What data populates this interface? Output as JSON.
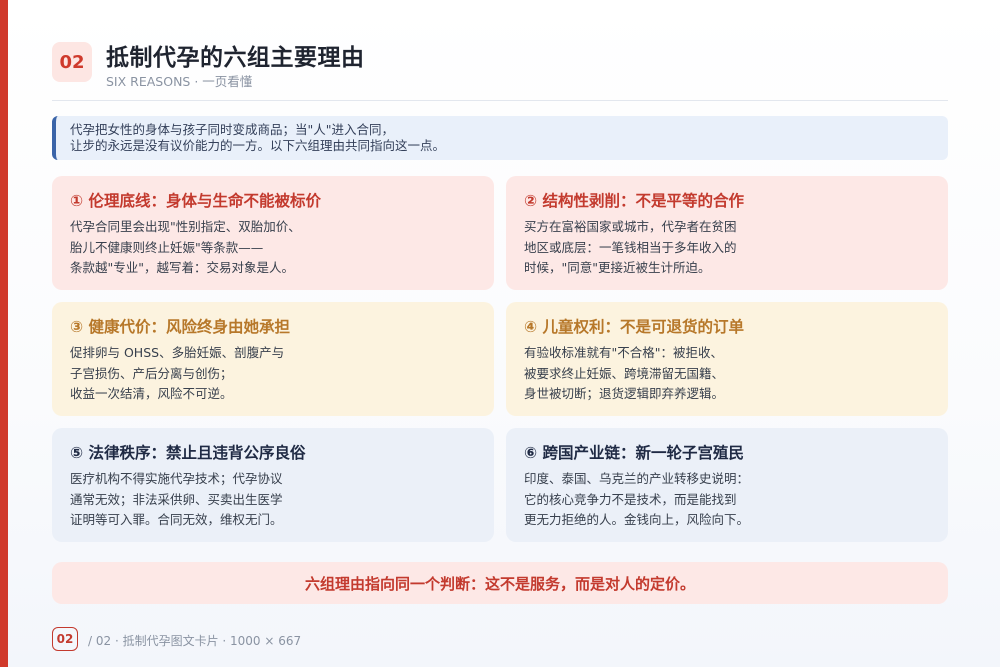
{
  "header": {
    "badge": "02",
    "title": "抵制代孕的六组主要理由",
    "subtitle": "SIX REASONS · 一页看懂"
  },
  "intro": {
    "lines": [
      "代孕把女性的身体与孩子同时变成商品；当\"人\"进入合同，",
      "让步的永远是没有议价能力的一方。以下六组理由共同指向这一点。"
    ]
  },
  "cards": [
    {
      "title": "① 伦理底线：身体与生命不能被标价",
      "lines": [
        "代孕合同里会出现\"性别指定、双胎加价、",
        "胎儿不健康则终止妊娠\"等条款——",
        "条款越\"专业\"，越写着：交易对象是人。"
      ]
    },
    {
      "title": "② 结构性剥削：不是平等的合作",
      "lines": [
        "买方在富裕国家或城市，代孕者在贫困",
        "地区或底层：一笔钱相当于多年收入的",
        "时候，\"同意\"更接近被生计所迫。"
      ]
    },
    {
      "title": "③ 健康代价：风险终身由她承担",
      "lines": [
        "促排卵与 OHSS、多胎妊娠、剖腹产与",
        "子宫损伤、产后分离与创伤；",
        "收益一次结清，风险不可逆。"
      ]
    },
    {
      "title": "④ 儿童权利：不是可退货的订单",
      "lines": [
        "有验收标准就有\"不合格\"：被拒收、",
        "被要求终止妊娠、跨境滞留无国籍、",
        "身世被切断；退货逻辑即弃养逻辑。"
      ]
    },
    {
      "title": "⑤ 法律秩序：禁止且违背公序良俗",
      "lines": [
        "医疗机构不得实施代孕技术；代孕协议",
        "通常无效；非法采供卵、买卖出生医学",
        "证明等可入罪。合同无效，维权无门。"
      ]
    },
    {
      "title": "⑥ 跨国产业链：新一轮子宫殖民",
      "lines": [
        "印度、泰国、乌克兰的产业转移史说明：",
        "它的核心竞争力不是技术，而是能找到",
        "更无力拒绝的人。金钱向上，风险向下。"
      ]
    }
  ],
  "conclusion": "六组理由指向同一个判断：这不是服务，而是对人的定价。",
  "footer": {
    "badge": "02",
    "text": "/ 02 · 抵制代孕图文卡片 · 1000 × 667"
  },
  "colors": {
    "accent": "#d0392b",
    "card_red": "#fde8e6",
    "card_yellow": "#fcf3df",
    "card_blue": "#ebf0f8"
  }
}
